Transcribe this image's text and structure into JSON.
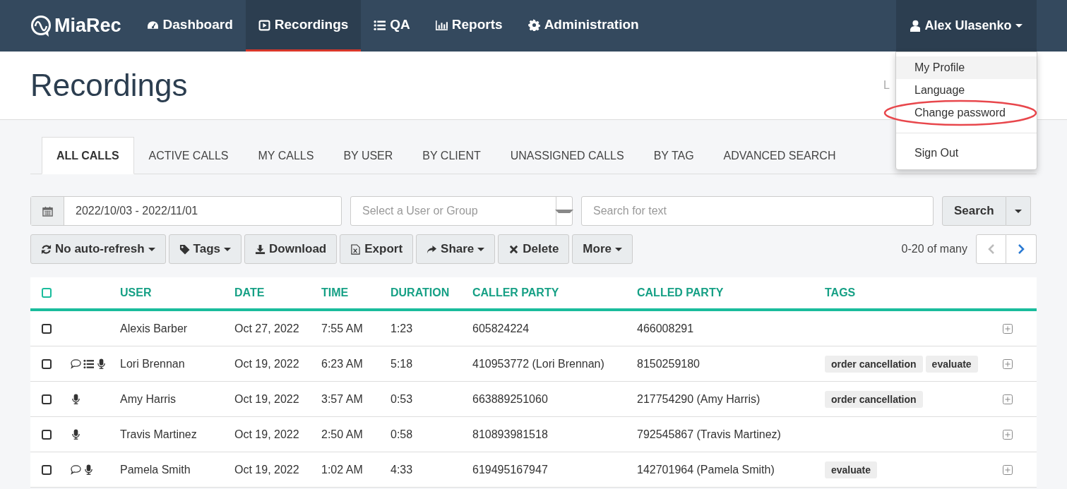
{
  "navbar": {
    "brand": "MiaRec",
    "items": [
      {
        "label": "Dashboard",
        "kind": "gauge",
        "selected": false
      },
      {
        "label": "Recordings",
        "kind": "play",
        "selected": true
      },
      {
        "label": "QA",
        "kind": "list",
        "selected": false
      },
      {
        "label": "Reports",
        "kind": "chart",
        "selected": false
      },
      {
        "label": "Administration",
        "kind": "gear",
        "selected": false
      }
    ],
    "user": {
      "name": "Alex Ulasenko",
      "expanded": true
    }
  },
  "user_menu": [
    {
      "label": "My Profile",
      "highlighted": true,
      "circled": false
    },
    {
      "label": "Language",
      "highlighted": false,
      "circled": false
    },
    {
      "label": "Change password",
      "highlighted": false,
      "circled": true
    },
    {
      "label": "Sign Out",
      "highlighted": false,
      "circled": false
    }
  ],
  "page_title": "Recordings",
  "header_right_text": "L",
  "tabs": [
    {
      "label": "ALL CALLS",
      "selected": true
    },
    {
      "label": "ACTIVE CALLS",
      "selected": false
    },
    {
      "label": "MY CALLS",
      "selected": false
    },
    {
      "label": "BY USER",
      "selected": false
    },
    {
      "label": "BY CLIENT",
      "selected": false
    },
    {
      "label": "UNASSIGNED CALLS",
      "selected": false
    },
    {
      "label": "BY TAG",
      "selected": false
    },
    {
      "label": "ADVANCED SEARCH",
      "selected": false
    }
  ],
  "filters": {
    "date_range": "2022/10/03 - 2022/11/01",
    "user_select": {
      "placeholder": "Select a User or Group"
    },
    "search": {
      "placeholder": "Search for text"
    },
    "search_button": "Search"
  },
  "toolbar": [
    {
      "label": "No auto-refresh",
      "kind": "refresh",
      "caret": true
    },
    {
      "label": "Tags",
      "kind": "tag",
      "caret": true
    },
    {
      "label": "Download",
      "kind": "download",
      "caret": false
    },
    {
      "label": "Export",
      "kind": "excel",
      "caret": false
    },
    {
      "label": "Share",
      "kind": "share",
      "caret": true
    },
    {
      "label": "Delete",
      "kind": "close",
      "caret": false
    },
    {
      "label": "More",
      "kind": "plain",
      "caret": true
    }
  ],
  "pagination": {
    "range": "0-20 of many",
    "prev_disabled": true,
    "next_disabled": false
  },
  "table": {
    "select_all_checked": false,
    "columns": [
      "USER",
      "DATE",
      "TIME",
      "DURATION",
      "CALLER PARTY",
      "CALLED PARTY",
      "TAGS"
    ],
    "rows": [
      {
        "checked": false,
        "icons": [],
        "user": "Alexis Barber",
        "date": "Oct 27, 2022",
        "time": "7:55 AM",
        "duration": "1:23",
        "caller": "605824224",
        "called": "466008291",
        "tags": []
      },
      {
        "checked": false,
        "icons": [
          {
            "kind": "comment"
          },
          {
            "kind": "list"
          },
          {
            "kind": "mic"
          }
        ],
        "user": "Lori Brennan",
        "date": "Oct 19, 2022",
        "time": "6:23 AM",
        "duration": "5:18",
        "caller": "410953772 (Lori Brennan)",
        "called": "8150259180",
        "tags": [
          "order cancellation",
          "evaluate"
        ]
      },
      {
        "checked": false,
        "icons": [
          {
            "kind": "mic"
          }
        ],
        "user": "Amy Harris",
        "date": "Oct 19, 2022",
        "time": "3:57 AM",
        "duration": "0:53",
        "caller": "663889251060",
        "called": "217754290 (Amy Harris)",
        "tags": [
          "order cancellation"
        ]
      },
      {
        "checked": false,
        "icons": [
          {
            "kind": "mic"
          }
        ],
        "user": "Travis Martinez",
        "date": "Oct 19, 2022",
        "time": "2:50 AM",
        "duration": "0:58",
        "caller": "810893981518",
        "called": "792545867 (Travis Martinez)",
        "tags": []
      },
      {
        "checked": false,
        "icons": [
          {
            "kind": "comment"
          },
          {
            "kind": "mic"
          }
        ],
        "user": "Pamela Smith",
        "date": "Oct 19, 2022",
        "time": "1:02 AM",
        "duration": "4:33",
        "caller": "619495167947",
        "called": "142701964 (Pamela Smith)",
        "tags": [
          "evaluate"
        ]
      }
    ]
  }
}
